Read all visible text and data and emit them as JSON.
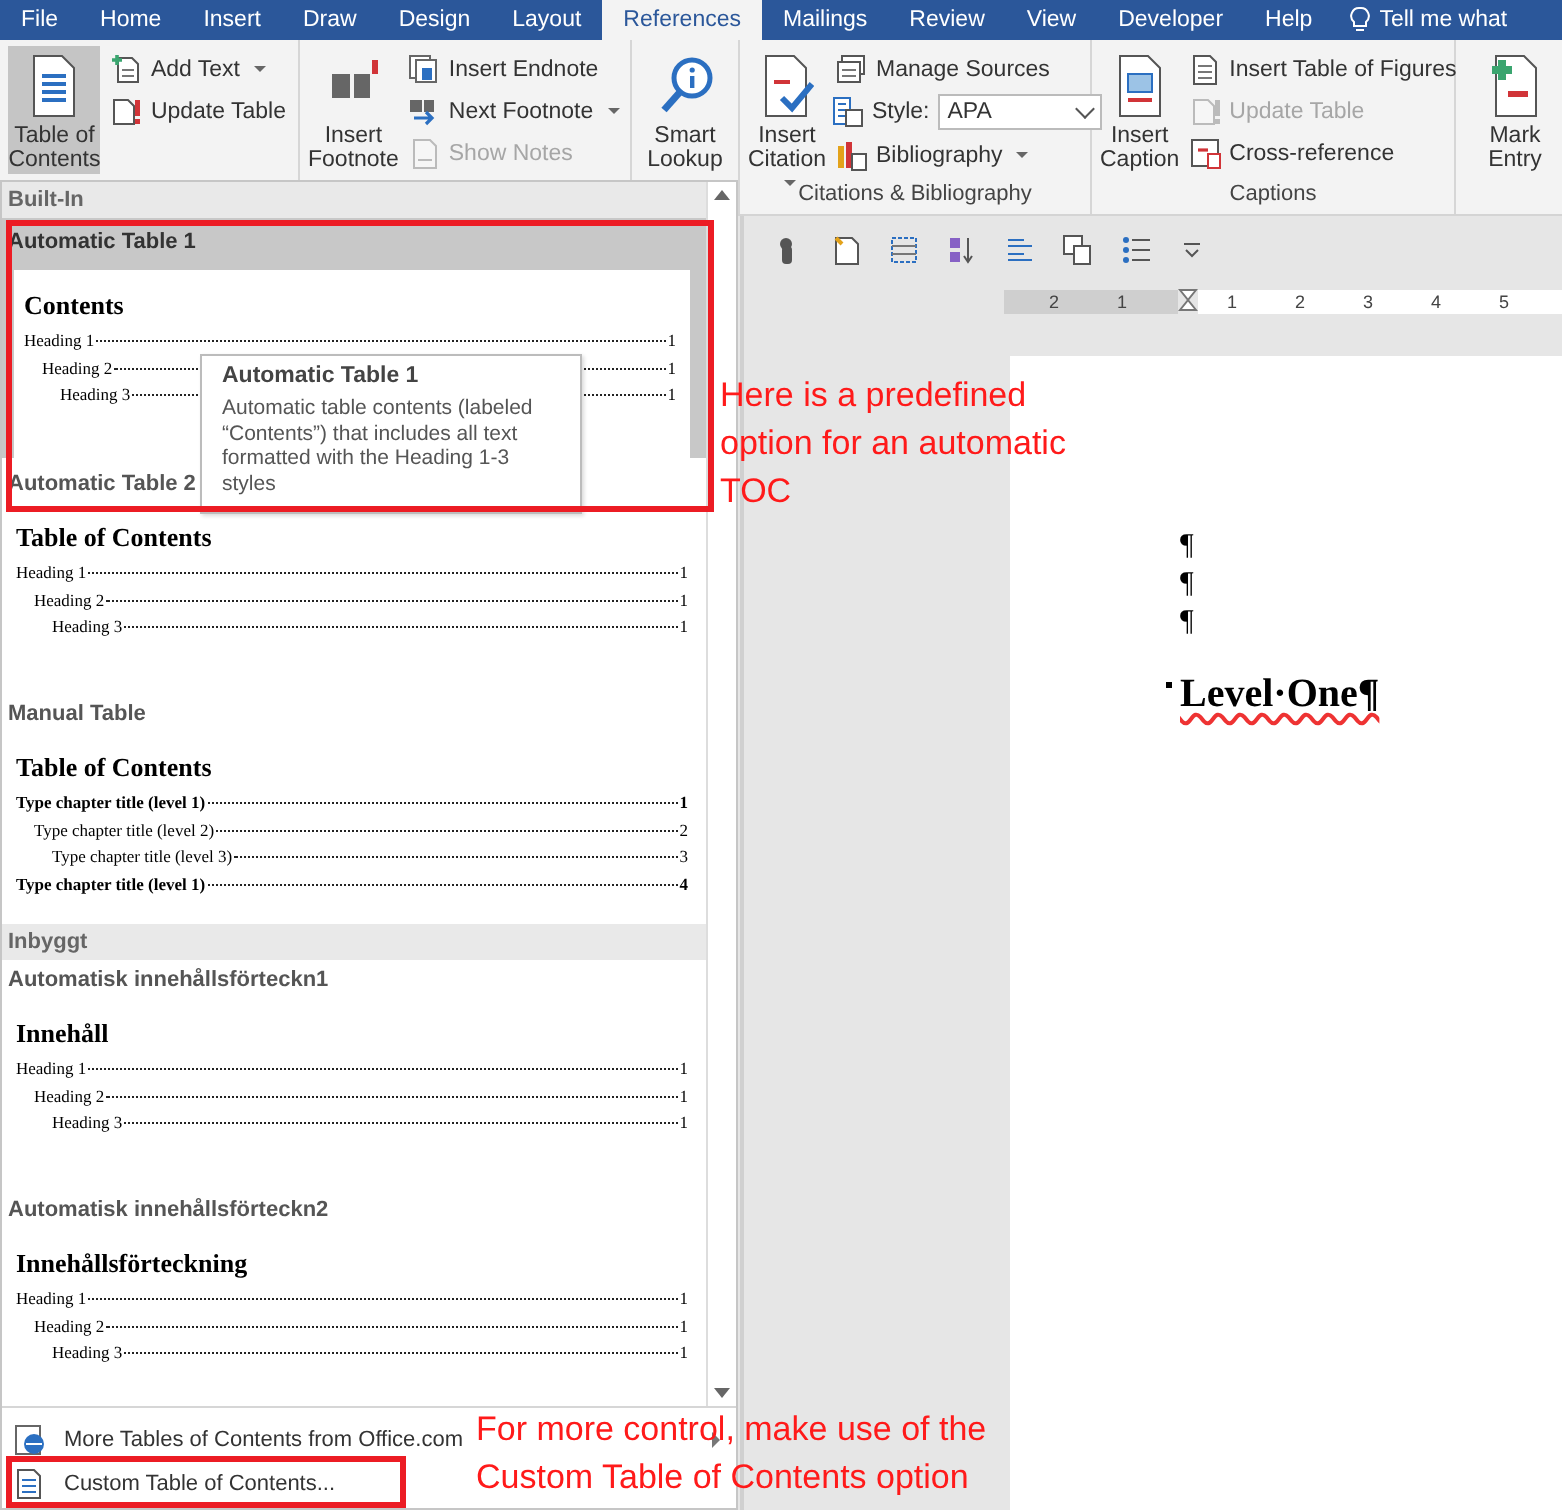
{
  "tabs": [
    {
      "label": "File",
      "selected": false
    },
    {
      "label": "Home",
      "selected": false
    },
    {
      "label": "Insert",
      "selected": false
    },
    {
      "label": "Draw",
      "selected": false
    },
    {
      "label": "Design",
      "selected": false
    },
    {
      "label": "Layout",
      "selected": false
    },
    {
      "label": "References",
      "selected": true
    },
    {
      "label": "Mailings",
      "selected": false
    },
    {
      "label": "Review",
      "selected": false
    },
    {
      "label": "View",
      "selected": false
    },
    {
      "label": "Developer",
      "selected": false
    },
    {
      "label": "Help",
      "selected": false
    }
  ],
  "tell_me": "Tell me what",
  "ribbon_groups": [
    {
      "items": [
        {
          "kind": "large",
          "label": "Table of Contents",
          "dropdown": true,
          "pressed": true
        },
        {
          "kind": "column",
          "items": [
            {
              "kind": "small",
              "label": "Add Text",
              "dropdown": true,
              "disabled": false
            },
            {
              "kind": "small",
              "label": "Update Table",
              "dropdown": false,
              "disabled": false
            }
          ]
        }
      ]
    },
    {
      "items": [
        {
          "kind": "large",
          "label": "Insert Footnote",
          "dropdown": false,
          "pressed": false
        },
        {
          "kind": "column",
          "items": [
            {
              "kind": "small",
              "label": "Insert Endnote",
              "dropdown": false,
              "disabled": false
            },
            {
              "kind": "small",
              "label": "Next Footnote",
              "dropdown": true,
              "disabled": false
            },
            {
              "kind": "small",
              "label": "Show Notes",
              "dropdown": false,
              "disabled": true
            }
          ]
        }
      ]
    },
    {
      "items": [
        {
          "kind": "large",
          "label": "Smart Lookup",
          "dropdown": false,
          "pressed": false
        }
      ]
    },
    {
      "label": "Citations & Bibliography",
      "items": [
        {
          "kind": "large",
          "label": "Insert Citation",
          "dropdown": true,
          "pressed": false
        },
        {
          "kind": "column",
          "items": [
            {
              "kind": "small",
              "label": "Manage Sources",
              "dropdown": false,
              "disabled": false
            },
            {
              "kind": "combo",
              "label": "Style:",
              "value": "APA"
            },
            {
              "kind": "small",
              "label": "Bibliography",
              "dropdown": true,
              "disabled": false
            }
          ]
        }
      ]
    },
    {
      "label": "Captions",
      "items": [
        {
          "kind": "large",
          "label": "Insert Caption",
          "dropdown": false,
          "pressed": false
        },
        {
          "kind": "column",
          "items": [
            {
              "kind": "small",
              "label": "Insert Table of Figures",
              "dropdown": false,
              "disabled": false
            },
            {
              "kind": "small",
              "label": "Update Table",
              "dropdown": false,
              "disabled": true
            },
            {
              "kind": "small",
              "label": "Cross-reference",
              "dropdown": false,
              "disabled": false
            }
          ]
        }
      ]
    },
    {
      "items": [
        {
          "kind": "large",
          "label": "Mark Entry",
          "dropdown": false,
          "pressed": false
        }
      ]
    }
  ],
  "gallery": {
    "sections": [
      {
        "header": "Built-In",
        "entries": [
          {
            "title": "Automatic Table 1",
            "selected": true,
            "preview": {
              "heading": "Contents",
              "rows": [
                {
                  "text": "Heading 1",
                  "page": "1",
                  "children": [
                    {
                      "text": "Heading 2",
                      "page": "1",
                      "children": [
                        {
                          "text": "Heading 3",
                          "page": "1"
                        }
                      ]
                    }
                  ]
                }
              ]
            }
          },
          {
            "title": "Automatic Table 2",
            "selected": false,
            "preview": {
              "heading": "Table of Contents",
              "rows": [
                {
                  "text": "Heading 1",
                  "page": "1",
                  "children": [
                    {
                      "text": "Heading 2",
                      "page": "1",
                      "children": [
                        {
                          "text": "Heading 3",
                          "page": "1"
                        }
                      ]
                    }
                  ]
                }
              ]
            }
          },
          {
            "title": "Manual Table",
            "selected": false,
            "preview": {
              "heading": "Table of Contents",
              "rows": [
                {
                  "text": "Type chapter title (level 1)",
                  "page": "1",
                  "children": [
                    {
                      "text": "Type chapter title (level 2)",
                      "page": "2",
                      "children": [
                        {
                          "text": "Type chapter title (level 3)",
                          "page": "3"
                        }
                      ]
                    }
                  ]
                },
                {
                  "text": "Type chapter title (level 1)",
                  "page": "4"
                }
              ]
            }
          }
        ]
      },
      {
        "header": "Inbyggt",
        "entries": [
          {
            "title": "Automatisk innehållsförteckn1",
            "selected": false,
            "preview": {
              "heading": "Innehåll",
              "rows": [
                {
                  "text": "Heading 1",
                  "page": "1",
                  "children": [
                    {
                      "text": "Heading 2",
                      "page": "1",
                      "children": [
                        {
                          "text": "Heading 3",
                          "page": "1"
                        }
                      ]
                    }
                  ]
                }
              ]
            }
          },
          {
            "title": "Automatisk innehållsförteckn2",
            "selected": false,
            "preview": {
              "heading": "Innehållsförteckning",
              "rows": [
                {
                  "text": "Heading 1",
                  "page": "1",
                  "children": [
                    {
                      "text": "Heading 2",
                      "page": "1",
                      "children": [
                        {
                          "text": "Heading 3",
                          "page": "1"
                        }
                      ]
                    }
                  ]
                }
              ]
            }
          }
        ]
      }
    ],
    "footer": [
      {
        "label": "More Tables of Contents from Office.com",
        "submenu": true
      },
      {
        "label": "Custom Table of Contents...",
        "submenu": false
      }
    ]
  },
  "tooltip": {
    "title": "Automatic Table 1",
    "text": "Automatic table contents (labeled “Contents”) that includes all text formatted with the Heading 1-3 styles"
  },
  "document": {
    "ruler": [
      "2",
      "1",
      "1",
      "2",
      "3",
      "4",
      "5"
    ],
    "paragraphs": [
      {
        "kind": "empty",
        "text": "¶",
        "misspelled": false
      },
      {
        "kind": "empty",
        "text": "¶",
        "misspelled": false
      },
      {
        "kind": "empty",
        "text": "¶",
        "misspelled": false
      },
      {
        "kind": "heading",
        "text": "Level·One¶",
        "misspelled": true
      }
    ]
  },
  "annotations": [
    {
      "text": "Here is a predefined option for an automatic TOC"
    },
    {
      "text": "For more control, make use of the Custom Table of Contents option"
    }
  ]
}
